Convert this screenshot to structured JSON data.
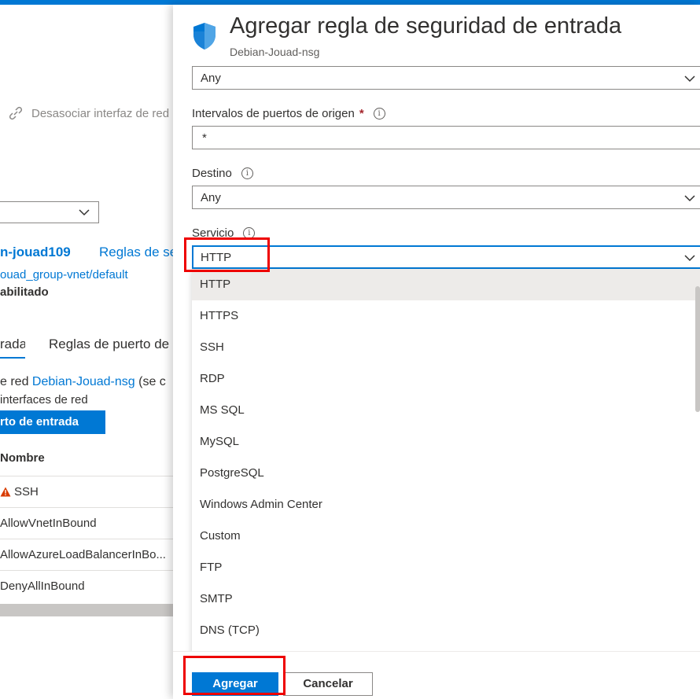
{
  "background": {
    "command_label": "Desasociar interfaz de red",
    "nic_name": "n-jouad109",
    "rules_link": "Reglas de se",
    "subnet": "ouad_group-vnet/default",
    "enabled_label": "abilitado",
    "tab_inbound": "rada",
    "tab_outbound": "Reglas de puerto de",
    "nsg_prefix": "e red ",
    "nsg_link": "Debian-Jouad-nsg",
    "nsg_suffix": " (se c",
    "interfaces_text": "interfaces de red",
    "add_rule_button": "rto de entrada",
    "column_name": "Nombre",
    "rows": [
      "SSH",
      "AllowVnetInBound",
      "AllowAzureLoadBalancerInBo...",
      "DenyAllInBound"
    ]
  },
  "panel": {
    "title": "Agregar regla de seguridad de entrada",
    "subtitle": "Debian-Jouad-nsg",
    "source_value": "Any",
    "source_ports_label": "Intervalos de puertos de origen",
    "source_ports_value": "*",
    "destination_label": "Destino",
    "destination_value": "Any",
    "service_label": "Servicio",
    "service_value": "HTTP",
    "service_options": [
      "HTTP",
      "HTTPS",
      "SSH",
      "RDP",
      "MS SQL",
      "MySQL",
      "PostgreSQL",
      "Windows Admin Center",
      "Custom",
      "FTP",
      "SMTP",
      "DNS (TCP)"
    ],
    "add_button": "Agregar",
    "cancel_button": "Cancelar"
  },
  "colors": {
    "accent": "#0078d4",
    "highlight": "#e00000",
    "warning": "#d83b01"
  }
}
